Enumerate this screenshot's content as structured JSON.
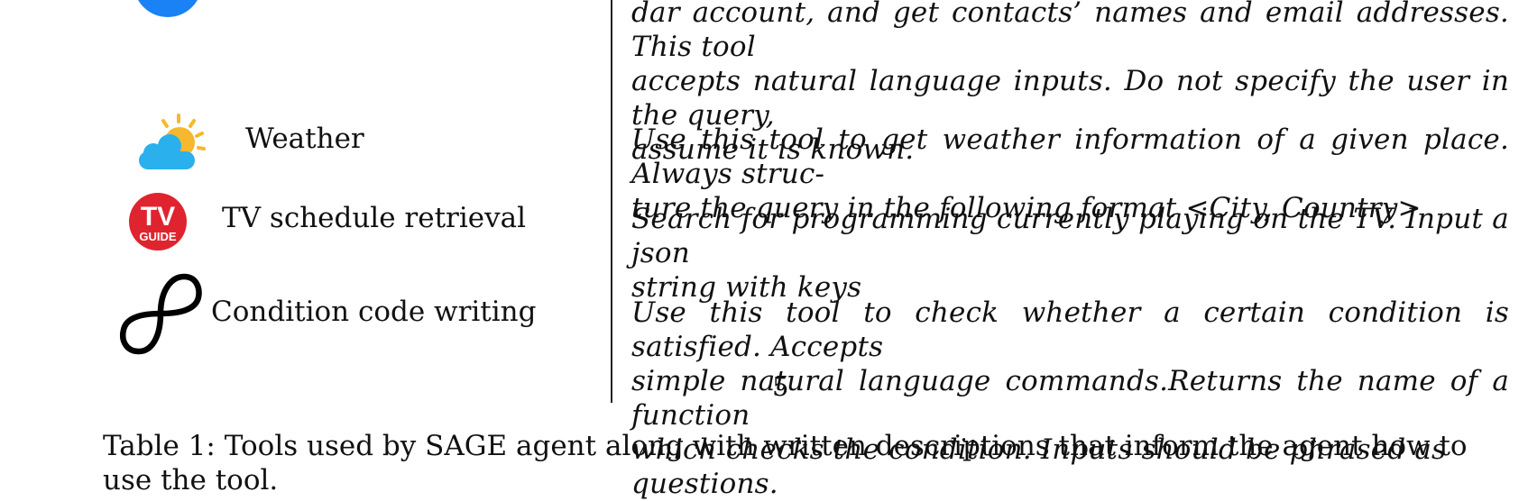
{
  "tools": [
    {
      "id": "contacts",
      "name": "",
      "icon": "blue-circle-icon",
      "description_lines": [
        "dar account, and get contacts’ names and email addresses. This tool",
        "accepts natural language inputs. Do not specify the user in the query,",
        "assume it is known."
      ]
    },
    {
      "id": "weather",
      "name": "Weather",
      "icon": "sun-cloud-icon",
      "description_lines": [
        "Use this tool to get weather information of a given place. Always struc-",
        "ture the query in the following format <City, Country>"
      ]
    },
    {
      "id": "tv",
      "name": "TV schedule retrieval",
      "icon": "tv-guide-logo-icon",
      "description_lines": [
        "Search for programming currently playing on the TV. Input a json",
        "string with keys"
      ]
    },
    {
      "id": "condition",
      "name": "Condition code writing",
      "icon": "infinity-loop-icon",
      "description_lines": [
        "Use this tool to check whether a certain condition is satisfied. Accepts",
        "simple natural language commands.Returns the name of a function",
        "which checks the condition. Inputs should be phrased as questions."
      ]
    }
  ],
  "tv_logo": {
    "line1": "TV",
    "line2": "GUIDE"
  },
  "page_number": "5",
  "caption": "Table 1: Tools used by SAGE agent along with written descriptions that inform the agent how to use the tool.",
  "colors": {
    "contacts_icon": "#1a82f5",
    "sun": "#f5b82e",
    "cloud": "#2ab0ec",
    "tv_logo": "#e0242f"
  }
}
